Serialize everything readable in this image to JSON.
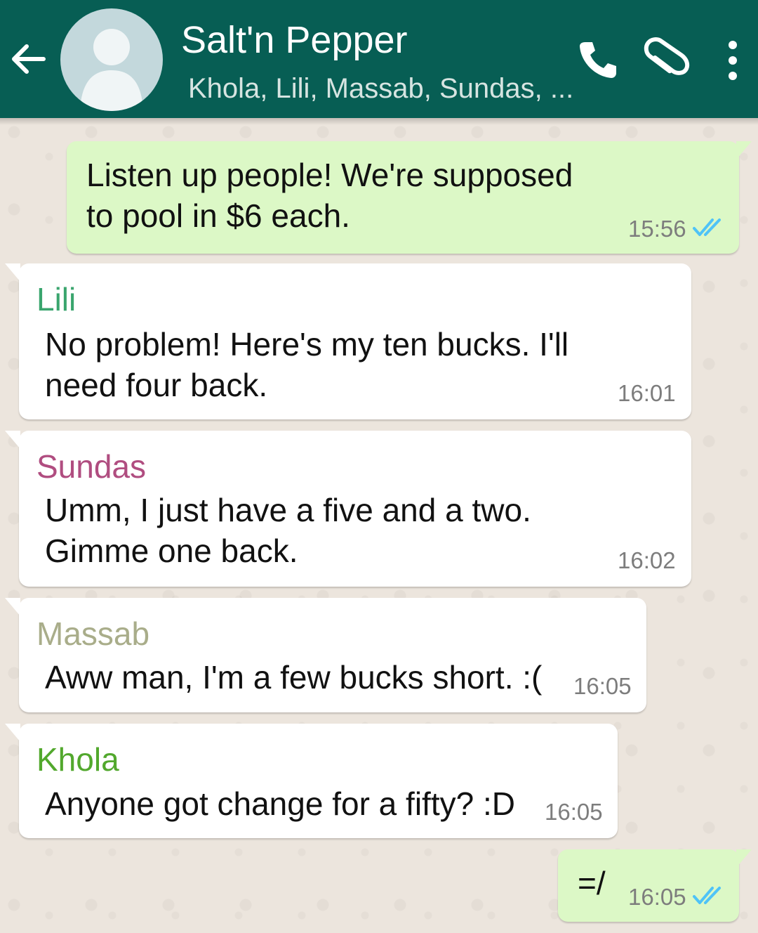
{
  "header": {
    "title": "Salt'n Pepper",
    "subtitle": "Khola, Lili, Massab, Sundas, ...",
    "background_color": "#075e54"
  },
  "messages": [
    {
      "direction": "out",
      "lines": [
        "Listen up people! We're supposed",
        "to pool in $6 each."
      ],
      "time": "15:56",
      "ticks": "read"
    },
    {
      "direction": "in",
      "sender": "Lili",
      "sender_color": "#3aa56e",
      "lines": [
        "No problem! Here's my ten bucks. I'll",
        "need four back."
      ],
      "time": "16:01"
    },
    {
      "direction": "in",
      "sender": "Sundas",
      "sender_color": "#b04d80",
      "lines": [
        "Umm, I just have a five and a two.",
        "Gimme one back."
      ],
      "time": "16:02"
    },
    {
      "direction": "in",
      "sender": "Massab",
      "sender_color": "#a9ad8a",
      "lines": [
        "Aww man, I'm a few bucks short. :("
      ],
      "time": "16:05"
    },
    {
      "direction": "in",
      "sender": "Khola",
      "sender_color": "#52a82d",
      "lines": [
        "Anyone got change for a fifty? :D"
      ],
      "time": "16:05"
    },
    {
      "direction": "out",
      "lines": [
        "=/"
      ],
      "time": "16:05",
      "ticks": "read"
    }
  ],
  "colors": {
    "outgoing_bubble": "#dcf8c6",
    "incoming_bubble": "#ffffff",
    "read_ticks": "#4fc3f7",
    "chat_background": "#ece5dd"
  }
}
